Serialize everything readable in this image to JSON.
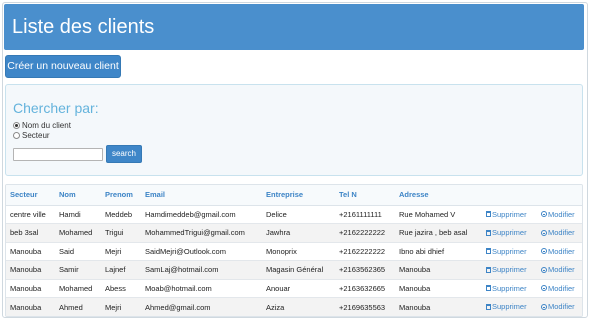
{
  "header": {
    "title": "Liste des clients"
  },
  "create_button": {
    "label": "Créer un nouveau client"
  },
  "search": {
    "title": "Chercher par:",
    "options": [
      {
        "label": "Nom du client",
        "checked": true
      },
      {
        "label": "Secteur",
        "checked": false
      }
    ],
    "input_value": "",
    "button_label": "search"
  },
  "table": {
    "columns": [
      "Secteur",
      "Nom",
      "Prenom",
      "Email",
      "Entreprise",
      "Tel N",
      "Adresse",
      "",
      ""
    ],
    "rows": [
      {
        "secteur": "centre ville",
        "nom": "Hamdi",
        "prenom": "Meddeb",
        "email": "Hamdimeddeb@gmail.com",
        "entreprise": "Delice",
        "tel": "+2161111111",
        "adresse": "Rue Mohamed V"
      },
      {
        "secteur": "beb 3sal",
        "nom": "Mohamed",
        "prenom": "Trigui",
        "email": "MohammedTrigui@gmail.com",
        "entreprise": "Jawhra",
        "tel": "+2162222222",
        "adresse": "Rue jazira , beb asal"
      },
      {
        "secteur": "Manouba",
        "nom": "Said",
        "prenom": "Mejri",
        "email": "SaidMejri@Outlook.com",
        "entreprise": "Monoprix",
        "tel": "+2162222222",
        "adresse": "Ibno abi dhief"
      },
      {
        "secteur": "Manouba",
        "nom": "Samir",
        "prenom": "Lajnef",
        "email": "SamLaj@hotmail.com",
        "entreprise": "Magasin Général",
        "tel": "+2163562365",
        "adresse": "Manouba"
      },
      {
        "secteur": "Manouba",
        "nom": "Mohamed",
        "prenom": "Abess",
        "email": "Moab@hotmail.com",
        "entreprise": "Anouar",
        "tel": "+2163632665",
        "adresse": "Manouba"
      },
      {
        "secteur": "Manouba",
        "nom": "Ahmed",
        "prenom": "Mejri",
        "email": "Ahmed@gmail.com",
        "entreprise": "Aziza",
        "tel": "+2169635563",
        "adresse": "Manouba"
      }
    ],
    "delete_label": "Supprimer",
    "edit_label": "Modifier"
  },
  "colors": {
    "header_bg": "#4a8fcd",
    "button_bg": "#3e86c8",
    "link": "#3d84c6",
    "search_title": "#64b3dc"
  },
  "icons": {
    "delete": "trash-icon",
    "edit": "edit-icon"
  }
}
